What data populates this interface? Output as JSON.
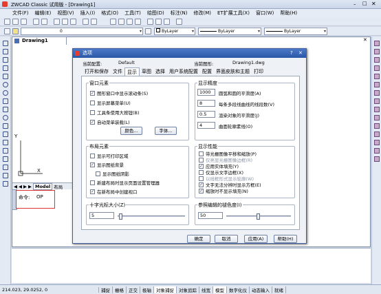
{
  "window": {
    "title": "ZWCAD Classic 试用版 - [Drawing1]"
  },
  "menu": [
    "文件(F)",
    "编辑(E)",
    "视图(V)",
    "插入(I)",
    "格式(O)",
    "工具(T)",
    "绘图(D)",
    "标注(N)",
    "修改(M)",
    "ET扩展工具(X)",
    "窗口(W)",
    "帮助(H)"
  ],
  "toolbar": {
    "layer_value": "0",
    "color_value": "ByLayer",
    "linetype_value": "ByLayer",
    "lineweight_value": "ByLayer"
  },
  "document": {
    "tab": "Drawing1",
    "layout_tabs": [
      "Model",
      "布局"
    ],
    "axis_labels": {
      "y": "Y",
      "x": "X"
    }
  },
  "command": {
    "prompt": "命令:",
    "value": "OP"
  },
  "statusbar": {
    "coords": "214.023, 29.0252, 0",
    "items": [
      "捕捉",
      "栅格",
      "正交",
      "极轴",
      "对象捕捉",
      "对象追踪",
      "线宽",
      "模型",
      "数字化仪",
      "动态输入",
      "就绪"
    ]
  },
  "dialog": {
    "title": "选项",
    "current_profile_label": "当前配置:",
    "current_profile_value": "Default",
    "current_drawing_label": "当前图形:",
    "current_drawing_value": "Drawing1.dwg",
    "tabs": [
      "打开和保存",
      "文件",
      "显示",
      "草图",
      "选择",
      "用户系统配置",
      "配置",
      "界面皮肤和主题",
      "打印"
    ],
    "active_tab": "显示",
    "window_elements": {
      "title": "窗口元素",
      "options": [
        {
          "label": "图形窗口中显示滚动条(S)",
          "checked": true
        },
        {
          "label": "显示屏幕菜单(U)",
          "checked": false
        },
        {
          "label": "工具条使用大按钮(B)",
          "checked": false
        },
        {
          "label": "自动菜单装载(L)",
          "checked": true
        }
      ],
      "color_button": "颜色...",
      "font_button": "字体..."
    },
    "display_resolution": {
      "title": "显示精度",
      "rows": [
        {
          "value": "1000",
          "label": "圆弧和圆的平滑度(A)"
        },
        {
          "value": "8",
          "label": "每条多段线曲线的线段数(V)"
        },
        {
          "value": "0.5",
          "label": "渲染对象的平滑度(J)"
        },
        {
          "value": "4",
          "label": "曲面轮廓素线(O)"
        }
      ]
    },
    "layout_elements": {
      "title": "布局元素",
      "options": [
        {
          "label": "显示可打印区域",
          "checked": false
        },
        {
          "label": "显示图纸背景",
          "checked": true
        },
        {
          "label": "显示图纸阴影",
          "checked": false
        },
        {
          "label": "新建布局时显示页面设置管理器",
          "checked": false
        },
        {
          "label": "在新布局中创建视口",
          "checked": true
        }
      ]
    },
    "display_performance": {
      "title": "显示性能",
      "options": [
        {
          "label": "带光栅图像平移和缩放(P)",
          "checked": false,
          "disabled": false
        },
        {
          "label": "仅亮显光栅图像边框(R)",
          "checked": false,
          "disabled": true
        },
        {
          "label": "应用实体填充(Y)",
          "checked": true,
          "disabled": false
        },
        {
          "label": "仅显示文字边框(X)",
          "checked": false,
          "disabled": false
        },
        {
          "label": "以线框形式显示轮廓(W)",
          "checked": false,
          "disabled": true
        },
        {
          "label": "文字无法分辨时显示方框(E)",
          "checked": true,
          "disabled": false
        },
        {
          "label": "缩放时不显示填充(N)",
          "checked": true,
          "disabled": false
        }
      ]
    },
    "crosshair": {
      "title": "十字光标大小(Z)",
      "value": "5"
    },
    "xref_fade": {
      "title": "参照编辑的褪色度(I)",
      "value": "50"
    },
    "buttons": {
      "ok": "确定",
      "cancel": "取消",
      "apply": "应用(A)",
      "help": "帮助(H)"
    }
  }
}
